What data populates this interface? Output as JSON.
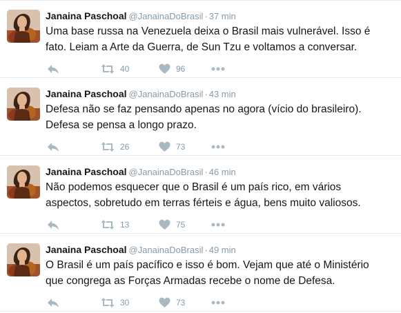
{
  "tweets": [
    {
      "author": "Janaina Paschoal",
      "handle": "@JanainaDoBrasil",
      "separator": "·",
      "time": "37 min",
      "text_lines": [
        "Uma base russa na Venezuela deixa o Brasil mais vulnerável. Isso é",
        "fato. Leiam a Arte da Guerra, de Sun Tzu e voltamos a conversar."
      ],
      "retweets": "40",
      "likes": "96"
    },
    {
      "author": "Janaina Paschoal",
      "handle": "@JanainaDoBrasil",
      "separator": "·",
      "time": "43 min",
      "text_lines": [
        "Defesa não se faz pensando apenas no agora (vício do brasileiro).",
        "Defesa se pensa a longo prazo."
      ],
      "retweets": "26",
      "likes": "73"
    },
    {
      "author": "Janaina Paschoal",
      "handle": "@JanainaDoBrasil",
      "separator": "·",
      "time": "46 min",
      "text_lines": [
        "Não podemos esquecer que o Brasil é um país rico, em vários",
        "aspectos, sobretudo em terras férteis e água, bens muito valiosos."
      ],
      "retweets": "13",
      "likes": "75"
    },
    {
      "author": "Janaina Paschoal",
      "handle": "@JanainaDoBrasil",
      "separator": "·",
      "time": "49 min",
      "text_lines": [
        "O Brasil é um país pacífico e isso é bom. Vejam que até o Ministério",
        "que congrega as Forças Armadas recebe o nome de Defesa."
      ],
      "retweets": "30",
      "likes": "73"
    }
  ],
  "icons": {
    "reply": "reply-icon",
    "retweet": "retweet-icon",
    "like": "heart-icon",
    "more": "more-icon"
  },
  "colors": {
    "text": "#14171a",
    "muted": "#8899a6",
    "icon": "#aab8c2",
    "divider": "#e6ecf0"
  }
}
